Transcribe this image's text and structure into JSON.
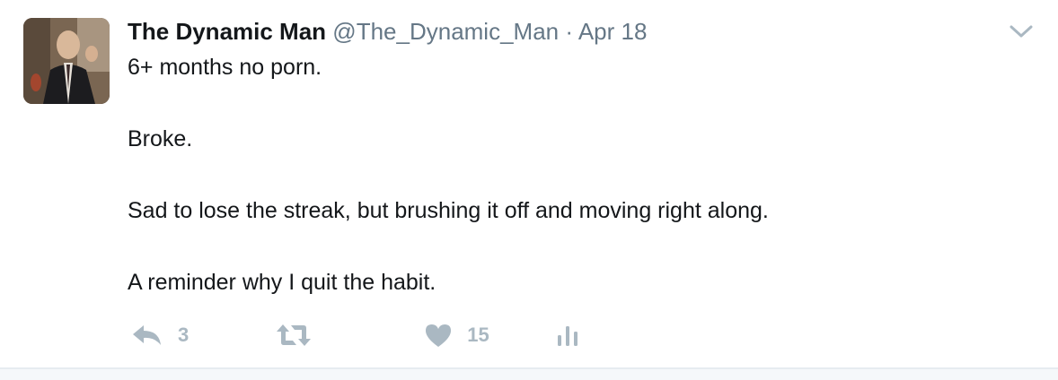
{
  "tweet": {
    "author_name": "The Dynamic Man",
    "handle": "@The_Dynamic_Man",
    "separator": "·",
    "date": "Apr 18",
    "paragraphs": [
      "6+ months no porn.",
      "Broke.",
      "Sad to lose the streak, but brushing it off and moving right along.",
      "A reminder why I quit the habit."
    ]
  },
  "actions": {
    "reply_count": "3",
    "retweet_count": "",
    "like_count": "15"
  },
  "icons": {
    "caret": "chevron-down-icon",
    "reply": "reply-icon",
    "retweet": "retweet-icon",
    "like": "heart-icon",
    "analytics": "analytics-icon"
  },
  "colors": {
    "name": "#14171a",
    "meta": "#657786",
    "action": "#aab8c2",
    "divider": "#e6ecf0"
  }
}
